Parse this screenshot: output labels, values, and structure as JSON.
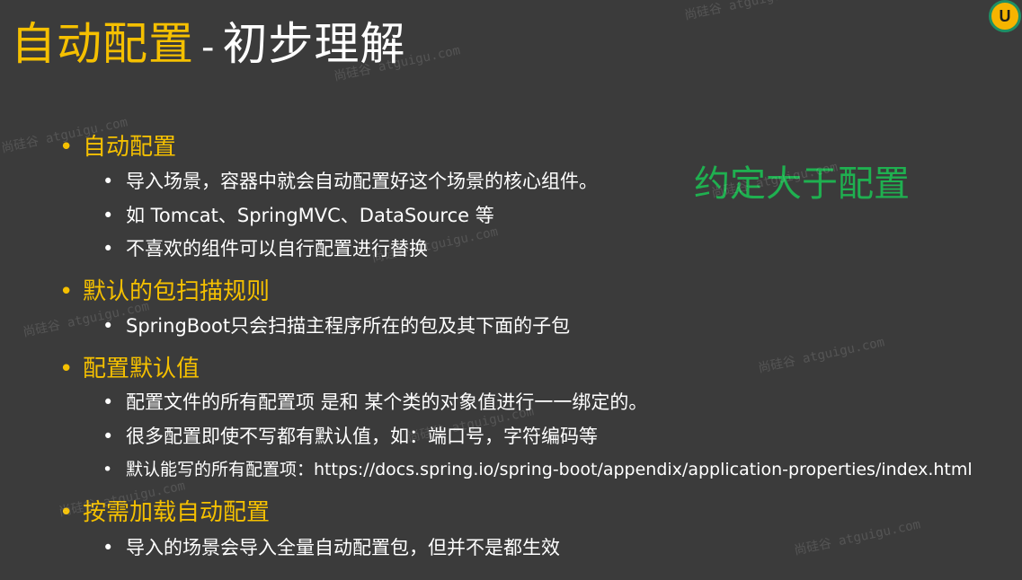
{
  "title": {
    "accent": "自动配置",
    "sep": "-",
    "rest": "初步理解"
  },
  "logo": {
    "letter": "U",
    "colors": {
      "fill": "#f6b400",
      "ring": "#1e8f64"
    }
  },
  "callout": {
    "text": "约定大于配置",
    "color": "#1fb050"
  },
  "sections": [
    {
      "heading": "自动配置",
      "items": [
        "导入场景，容器中就会自动配置好这个场景的核心组件。",
        "如 Tomcat、SpringMVC、DataSource 等",
        "不喜欢的组件可以自行配置进行替换"
      ]
    },
    {
      "heading": "默认的包扫描规则",
      "items": [
        "SpringBoot只会扫描主程序所在的包及其下面的子包"
      ]
    },
    {
      "heading": "配置默认值",
      "items": [
        "配置文件的所有配置项 是和 某个类的对象值进行一一绑定的。",
        "很多配置即使不写都有默认值，如：端口号，字符编码等",
        "默认能写的所有配置项：https://docs.spring.io/spring-boot/appendix/application-properties/index.html"
      ]
    },
    {
      "heading": "按需加载自动配置",
      "items": [
        "导入的场景会导入全量自动配置包，但并不是都生效"
      ]
    }
  ],
  "bullet": "•",
  "watermark": "尚硅谷 atguigu.com",
  "colors": {
    "background": "#3b3b3b",
    "accent": "#f5c000",
    "text": "#ffffff"
  }
}
